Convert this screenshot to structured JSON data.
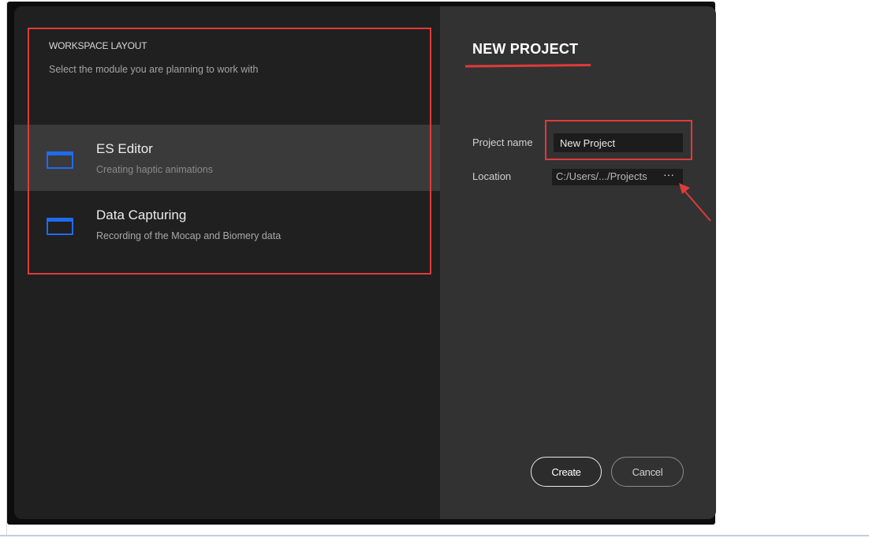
{
  "workspace": {
    "title": "WORKSPACE LAYOUT",
    "subtitle": "Select the module you are planning to work with",
    "modules": [
      {
        "name": "ES Editor",
        "description": "Creating haptic animations",
        "selected": true
      },
      {
        "name": "Data Capturing",
        "description": "Recording of the Mocap and Biomery data",
        "selected": false
      }
    ]
  },
  "new_project": {
    "title": "NEW PROJECT",
    "project_name_label": "Project name",
    "project_name_value": "New Project",
    "location_label": "Location",
    "location_value": "C:/Users/.../Projects",
    "location_more": "···"
  },
  "buttons": {
    "create": "Create",
    "cancel": "Cancel"
  },
  "colors": {
    "annotation": "#e03a3a",
    "module_icon": "#1f6bf0",
    "left_pane": "#202020",
    "right_pane": "#323232"
  },
  "icons": {
    "module": "window-icon",
    "location_more": "ellipsis-icon"
  }
}
